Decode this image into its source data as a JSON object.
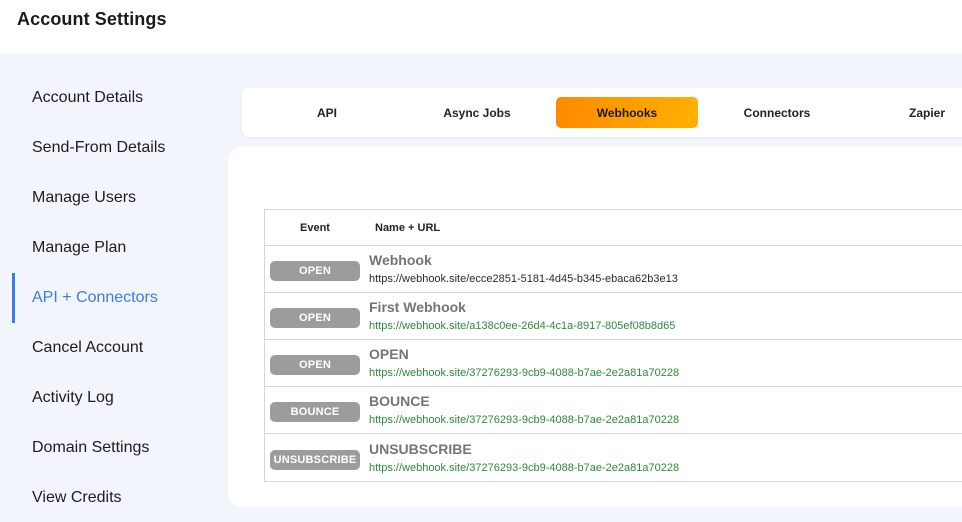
{
  "header": {
    "title": "Account Settings"
  },
  "sidebar": {
    "items": [
      {
        "label": "Account Details",
        "active": false
      },
      {
        "label": "Send-From Details",
        "active": false
      },
      {
        "label": "Manage Users",
        "active": false
      },
      {
        "label": "Manage Plan",
        "active": false
      },
      {
        "label": "API + Connectors",
        "active": true
      },
      {
        "label": "Cancel Account",
        "active": false
      },
      {
        "label": "Activity Log",
        "active": false
      },
      {
        "label": "Domain Settings",
        "active": false
      },
      {
        "label": "View Credits",
        "active": false
      }
    ]
  },
  "tabs": [
    {
      "label": "API",
      "active": false
    },
    {
      "label": "Async Jobs",
      "active": false
    },
    {
      "label": "Webhooks",
      "active": true
    },
    {
      "label": "Connectors",
      "active": false
    },
    {
      "label": "Zapier",
      "active": false
    }
  ],
  "table": {
    "headers": {
      "event": "Event",
      "name_url": "Name + URL"
    },
    "rows": [
      {
        "event": "OPEN",
        "name": "Webhook",
        "url": "https://webhook.site/ecce2851-5181-4d45-b345-ebaca62b3e13"
      },
      {
        "event": "OPEN",
        "name": "First Webhook",
        "url": "https://webhook.site/a138c0ee-26d4-4c1a-8917-805ef08b8d65"
      },
      {
        "event": "OPEN",
        "name": "OPEN",
        "url": "https://webhook.site/37276293-9cb9-4088-b7ae-2e2a81a70228"
      },
      {
        "event": "BOUNCE",
        "name": "BOUNCE",
        "url": "https://webhook.site/37276293-9cb9-4088-b7ae-2e2a81a70228"
      },
      {
        "event": "UNSUBSCRIBE",
        "name": "UNSUBSCRIBE",
        "url": "https://webhook.site/37276293-9cb9-4088-b7ae-2e2a81a70228"
      }
    ]
  },
  "colors": {
    "accent_blue": "#3b7be8",
    "tab_active_gradient_start": "#ff8a00",
    "tab_active_gradient_end": "#ffb000",
    "badge_gray": "#9c9c9c",
    "url_green": "#2e8a3c"
  }
}
